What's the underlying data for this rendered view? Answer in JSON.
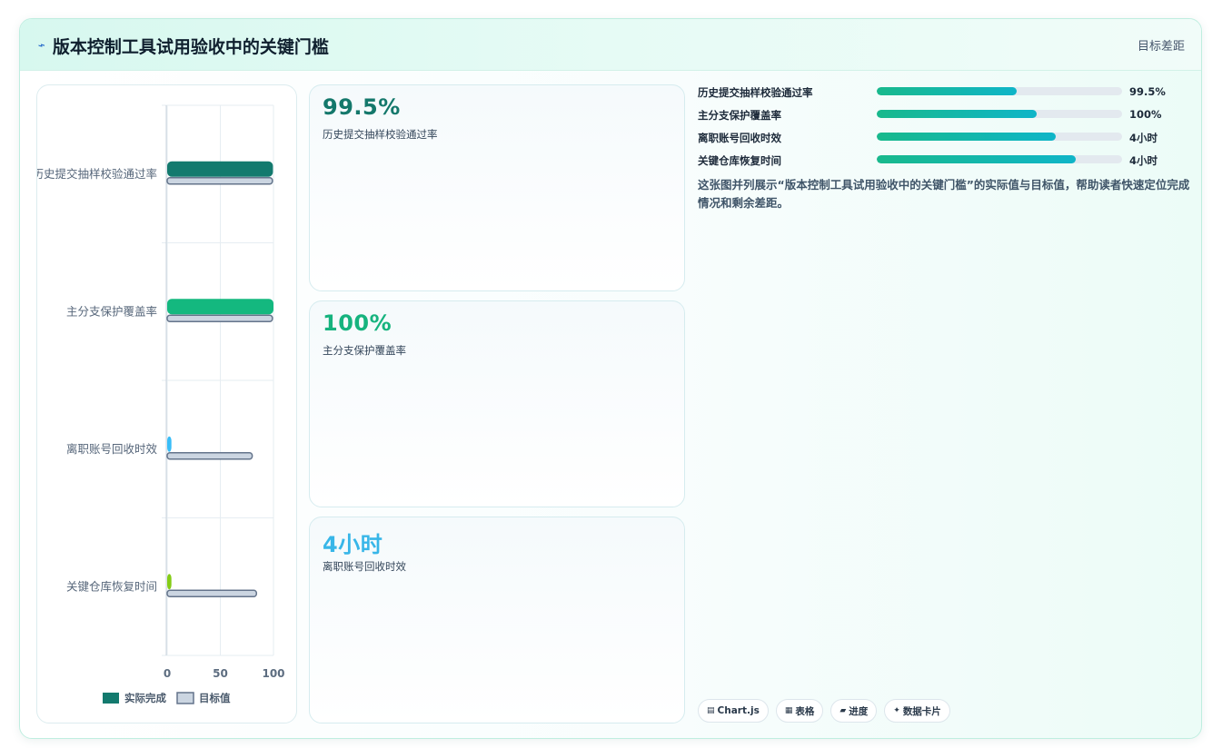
{
  "header": {
    "title": "版本控制工具试用验收中的关键门槛",
    "subtitle": "目标差距",
    "icon": "lightning-icon"
  },
  "chart_data": {
    "type": "bar",
    "orientation": "horizontal",
    "categories": [
      "历史提交抽样校验通过率",
      "主分支保护覆盖率",
      "离职账号回收时效",
      "关键仓库恢复时间"
    ],
    "series": [
      {
        "name": "实际完成",
        "values": [
          99.5,
          100,
          4,
          4
        ],
        "colors": [
          "#137a6e",
          "#14b87f",
          "#38bdf8",
          "#84cc16"
        ]
      },
      {
        "name": "目标值",
        "values": [
          99,
          99,
          80,
          84
        ],
        "color": "#cbd5e1",
        "stroke": "#64748b"
      }
    ],
    "xlim": [
      0,
      100
    ],
    "xticks": [
      "0",
      "50",
      "100"
    ],
    "grid": true,
    "legend": "bottom"
  },
  "kpis": [
    {
      "value": "99.5%",
      "label": "历史提交抽样校验通过率",
      "color": "#14786b"
    },
    {
      "value": "100%",
      "label": "主分支保护覆盖率",
      "color": "#16b37e"
    },
    {
      "value": "4小时",
      "label": "离职账号回收时效",
      "color": "#38b6e8"
    }
  ],
  "progress": [
    {
      "label": "历史提交抽样校验通过率",
      "value": "99.5%",
      "fill_fraction": 0.57
    },
    {
      "label": "主分支保护覆盖率",
      "value": "100%",
      "fill_fraction": 0.65
    },
    {
      "label": "离职账号回收时效",
      "value": "4小时",
      "fill_fraction": 0.73
    },
    {
      "label": "关键仓库恢复时间",
      "value": "4小时",
      "fill_fraction": 0.81
    }
  ],
  "description": "这张图并列展示“版本控制工具试用验收中的关键门槛”的实际值与目标值，帮助读者快速定位完成情况和剩余差距。",
  "tags": [
    {
      "icon": "▤",
      "label": "Chart.js"
    },
    {
      "icon": "▦",
      "label": "表格"
    },
    {
      "icon": "▰",
      "label": "进度"
    },
    {
      "icon": "✦",
      "label": "数据卡片"
    }
  ]
}
